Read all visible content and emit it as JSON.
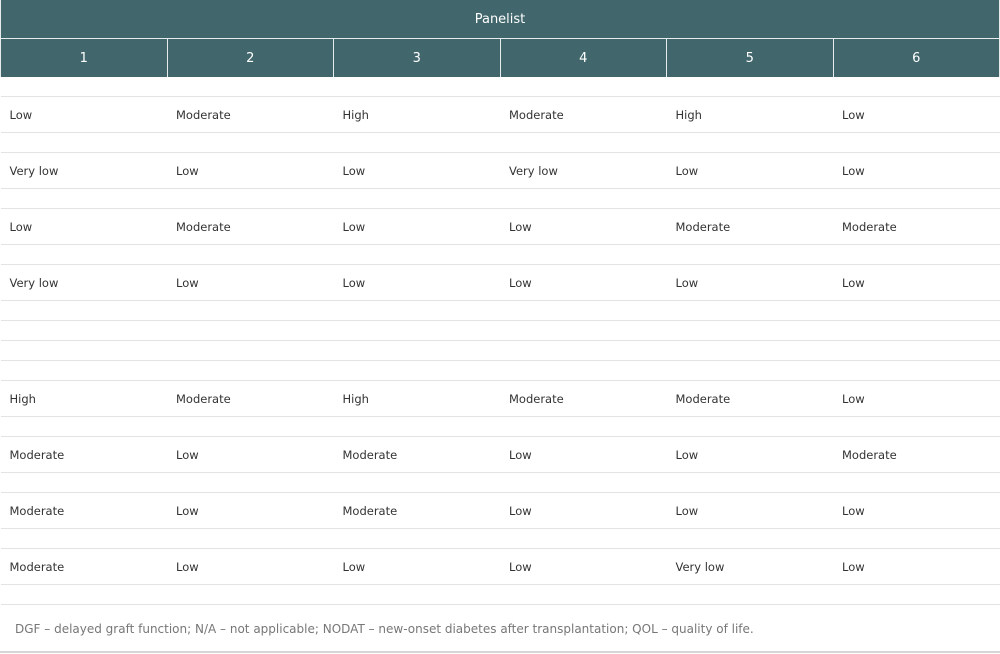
{
  "table": {
    "group_header": "Panelist",
    "columns": [
      "1",
      "2",
      "3",
      "4",
      "5",
      "6"
    ],
    "rows": [
      {
        "type": "spacer"
      },
      {
        "type": "data",
        "cells": [
          "Low",
          "Moderate",
          "High",
          "Moderate",
          "High",
          "Low"
        ]
      },
      {
        "type": "spacer"
      },
      {
        "type": "data",
        "cells": [
          "Very low",
          "Low",
          "Low",
          "Very low",
          "Low",
          "Low"
        ]
      },
      {
        "type": "spacer"
      },
      {
        "type": "data",
        "cells": [
          "Low",
          "Moderate",
          "Low",
          "Low",
          "Moderate",
          "Moderate"
        ]
      },
      {
        "type": "spacer"
      },
      {
        "type": "data",
        "cells": [
          "Very low",
          "Low",
          "Low",
          "Low",
          "Low",
          "Low"
        ]
      },
      {
        "type": "spacer"
      },
      {
        "type": "spacer"
      },
      {
        "type": "spacer"
      },
      {
        "type": "spacer"
      },
      {
        "type": "data",
        "cells": [
          "High",
          "Moderate",
          "High",
          "Moderate",
          "Moderate",
          "Low"
        ]
      },
      {
        "type": "spacer"
      },
      {
        "type": "data",
        "cells": [
          "Moderate",
          "Low",
          "Moderate",
          "Low",
          "Low",
          "Moderate"
        ]
      },
      {
        "type": "spacer"
      },
      {
        "type": "data",
        "cells": [
          "Moderate",
          "Low",
          "Moderate",
          "Low",
          "Low",
          "Low"
        ]
      },
      {
        "type": "spacer"
      },
      {
        "type": "data",
        "cells": [
          "Moderate",
          "Low",
          "Low",
          "Low",
          "Very low",
          "Low"
        ]
      },
      {
        "type": "spacer"
      }
    ]
  },
  "footnote": "DGF – delayed graft function; N/A – not applicable; NODAT – new-onset diabetes after transplantation; QOL – quality of life."
}
